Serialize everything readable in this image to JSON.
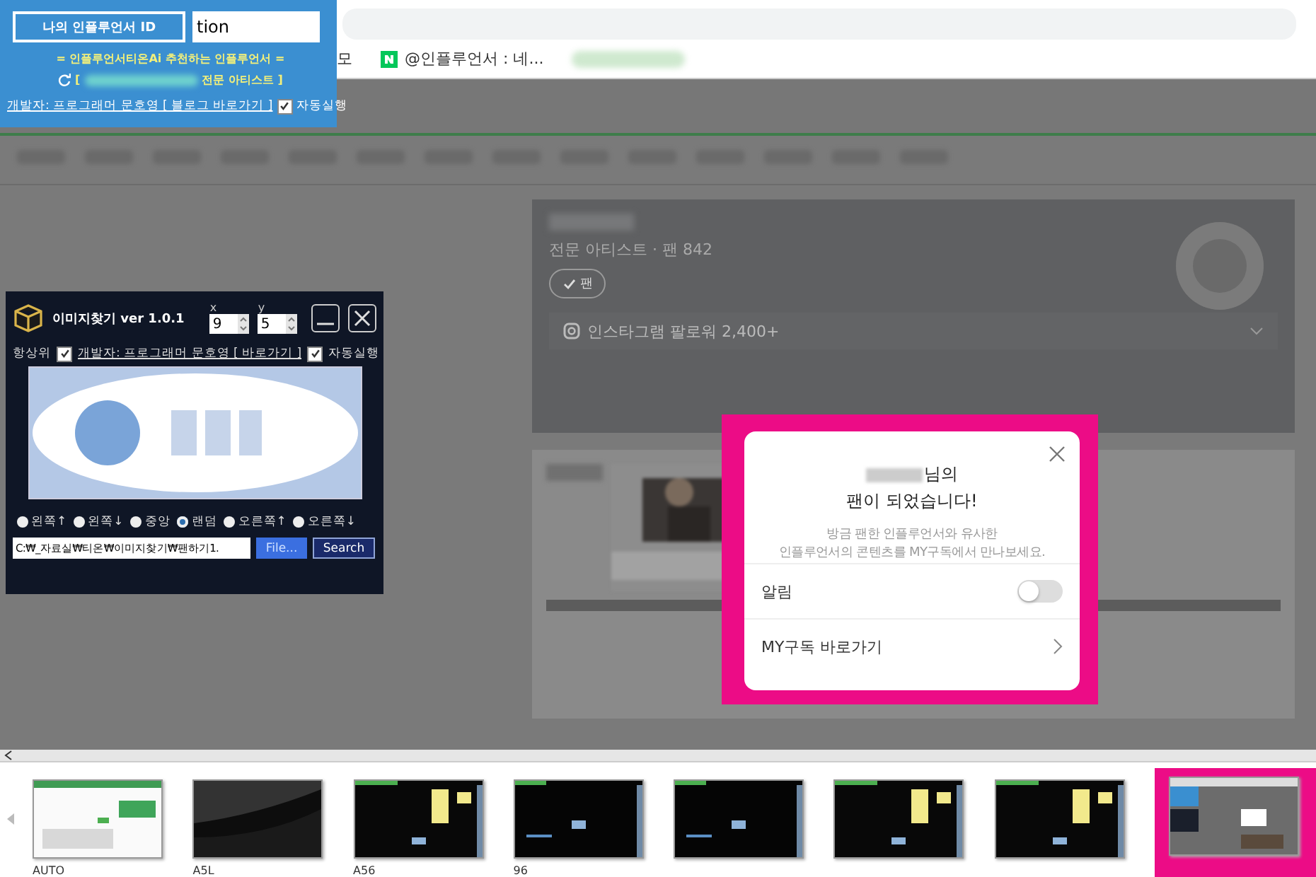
{
  "browser": {
    "bookmarks": [
      {
        "label": "모",
        "kind": "plain"
      },
      {
        "label": "@인플루언서 : 네...",
        "kind": "naver"
      }
    ]
  },
  "profile": {
    "subtitle": "전문 아티스트 · 팬 842",
    "fan_button": "팬",
    "instagram": "인스타그램 팔로워 2,400+"
  },
  "modal": {
    "highlighted": true,
    "name_suffix": "님의",
    "title": "팬이 되었습니다!",
    "description": "방금 팬한 인플루언서와 유사한\n인플루언서의 콘텐츠를 MY구독에서 만나보세요.",
    "rows": [
      {
        "kind": "toggle",
        "label": "알림",
        "on": false
      },
      {
        "kind": "link",
        "label": "MY구독 바로가기"
      }
    ]
  },
  "id_window": {
    "id_button": "나의 인플루언서 ID",
    "id_value": "tion",
    "heading": "= 인플루언서티온Ai 추천하는 인플루언서 =",
    "recommend_open": "[",
    "recommend_label": "전문 아티스트 ]",
    "developer_link": "개발자: 프로그래머 문호영 [ 블로그 바로가기 ]",
    "autorun": {
      "label": "자동실행",
      "checked": true
    }
  },
  "finder": {
    "title": "이미지찾기 ver 1.0.1",
    "x_label": "x",
    "x_value": "9",
    "y_label": "y",
    "y_value": "5",
    "always_on_top": {
      "label": "항상위",
      "checked": true
    },
    "developer_link": "개발자: 프로그래머 문호영 [ 바로가기 ]",
    "autorun": {
      "label": "자동실행",
      "checked": true
    },
    "positions": [
      {
        "label": "왼쪽↑",
        "selected": false
      },
      {
        "label": "왼쪽↓",
        "selected": false
      },
      {
        "label": "중앙",
        "selected": false
      },
      {
        "label": "랜덤",
        "selected": true
      },
      {
        "label": "오른쪽↑",
        "selected": false
      },
      {
        "label": "오른쪽↓",
        "selected": false
      }
    ],
    "path": "C:₩_자료실₩티온₩이미지찾기₩팬하기1.",
    "file_button": "File...",
    "search_button": "Search"
  },
  "thumbnails": [
    {
      "label": "AUTO",
      "kind": "sheet",
      "selected": false
    },
    {
      "label": "A5L",
      "kind": "dark",
      "selected": false
    },
    {
      "label": "A56",
      "kind": "notes",
      "selected": false
    },
    {
      "label": "96",
      "kind": "black",
      "selected": false
    },
    {
      "kind": "black",
      "selected": false
    },
    {
      "kind": "notes",
      "selected": false
    },
    {
      "kind": "notes",
      "selected": false
    },
    {
      "kind": "browser",
      "selected": true
    }
  ]
}
